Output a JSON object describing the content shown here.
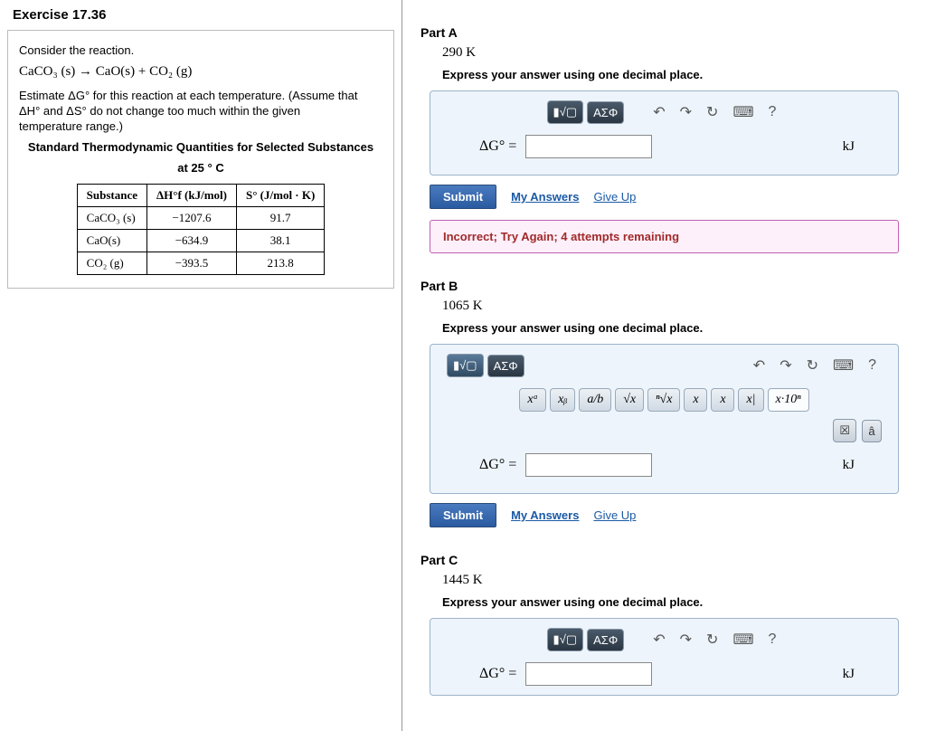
{
  "exercise": {
    "title": "Exercise 17.36"
  },
  "prompt": {
    "line1": "Consider the reaction.",
    "equation": "CaCO₃ (s) → CaO(s) + CO₂ (g)",
    "line2a": "Estimate ΔG° for this reaction at each temperature. (Assume that",
    "line2b": "ΔH° and ΔS° do not change too much within the given",
    "line2c": "temperature range.)",
    "thermoTitle1": "Standard Thermodynamic Quantities for Selected Substances",
    "thermoTitle2": "at 25 ° C"
  },
  "table": {
    "h1": "Substance",
    "h2": "ΔH°f (kJ/mol)",
    "h3": "S° (J/mol · K)",
    "rows": [
      {
        "s": "CaCO₃ (s)",
        "dh": "−1207.6",
        "so": "91.7"
      },
      {
        "s": "CaO(s)",
        "dh": "−634.9",
        "so": "38.1"
      },
      {
        "s": "CO₂ (g)",
        "dh": "−393.5",
        "so": "213.8"
      }
    ]
  },
  "labels": {
    "submit": "Submit",
    "myAnswers": "My Answers",
    "giveUp": "Give Up",
    "dg": "ΔG°  =",
    "unit": "kJ",
    "help": "?"
  },
  "partA": {
    "title": "Part A",
    "temp": "290  K",
    "instruct": "Express your answer using one decimal place.",
    "feedback": "Incorrect; Try Again; 4 attempts remaining"
  },
  "partB": {
    "title": "Part B",
    "temp": "1065  K",
    "instruct": "Express your answer using one decimal place.",
    "symbols": [
      "xᵃ",
      "xᵦ",
      "a/b",
      "√x",
      "ⁿ√x",
      "x",
      "x",
      "x|",
      "x·10ⁿ"
    ]
  },
  "partC": {
    "title": "Part C",
    "temp": "1445  K",
    "instruct": "Express your answer using one decimal place."
  }
}
